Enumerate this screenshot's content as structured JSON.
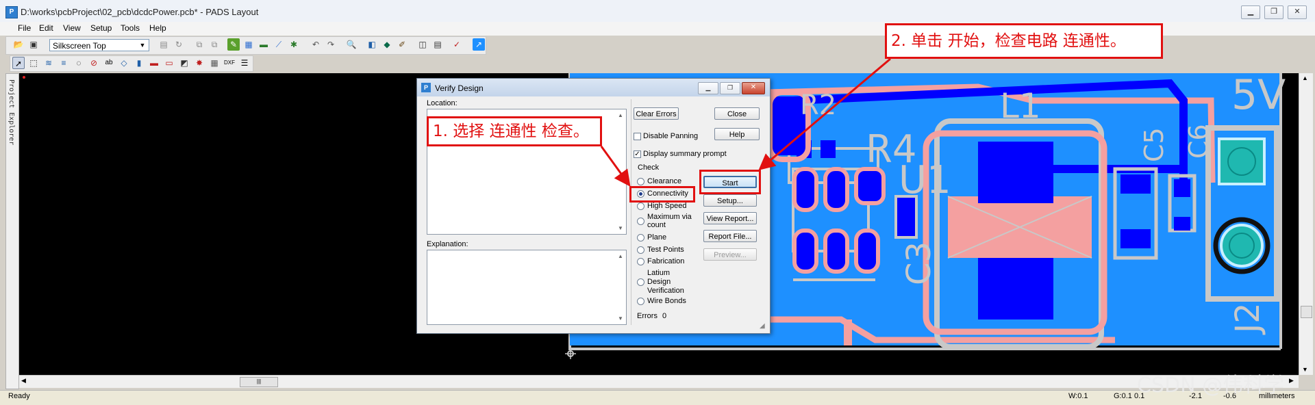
{
  "window": {
    "title": "D:\\works\\pcbProject\\02_pcb\\dcdcPower.pcb* - PADS Layout",
    "app_icon": "pads-icon"
  },
  "menu": [
    "File",
    "Edit",
    "View",
    "Setup",
    "Tools",
    "Help"
  ],
  "toolbar": {
    "layer_select": "Silkscreen Top"
  },
  "side_panel": {
    "label": "Project Explorer"
  },
  "pcb": {
    "silk_labels": [
      "5V",
      "L1",
      "R4",
      "U1",
      "C5",
      "C6",
      "C3",
      "J2",
      "R2"
    ],
    "colors": {
      "board": "#1e90ff",
      "trace": "#0000ff",
      "silk": "#f4a0a0",
      "pad": "#0000cc",
      "outline": "#c8c8c8",
      "connector": "#1fb8b0",
      "background": "#000000"
    }
  },
  "dialog": {
    "title": "Verify Design",
    "location_label": "Location:",
    "explanation_label": "Explanation:",
    "clear_errors": "Clear Errors",
    "close": "Close",
    "help": "Help",
    "disable_panning": "Disable Panning",
    "disable_panning_checked": false,
    "display_summary": "Display summary prompt",
    "display_summary_checked": true,
    "check_label": "Check",
    "options": [
      {
        "label": "Clearance",
        "selected": false
      },
      {
        "label": "Connectivity",
        "selected": true
      },
      {
        "label": "High Speed",
        "selected": false
      },
      {
        "label": "Maximum via count",
        "selected": false
      },
      {
        "label": "Plane",
        "selected": false
      },
      {
        "label": "Test Points",
        "selected": false
      },
      {
        "label": "Fabrication",
        "selected": false
      },
      {
        "label": "Latium Design Verification",
        "selected": false
      },
      {
        "label": "Wire Bonds",
        "selected": false
      }
    ],
    "start": "Start",
    "setup": "Setup...",
    "view_report": "View Report...",
    "report_file": "Report File...",
    "preview": "Preview...",
    "errors_label": "Errors",
    "errors_count": "0"
  },
  "annotations": {
    "step1": "1. 选择 连通性 检查。",
    "step2": "2. 单击 开始，检查电路 连通性。",
    "color": "#e11010"
  },
  "status": {
    "ready": "Ready",
    "w": "W:0.1",
    "g": "G:0.1 0.1",
    "x": "-2.1",
    "y": "-0.6",
    "units": "millimeters"
  },
  "watermark": "CSDN @伟科学"
}
